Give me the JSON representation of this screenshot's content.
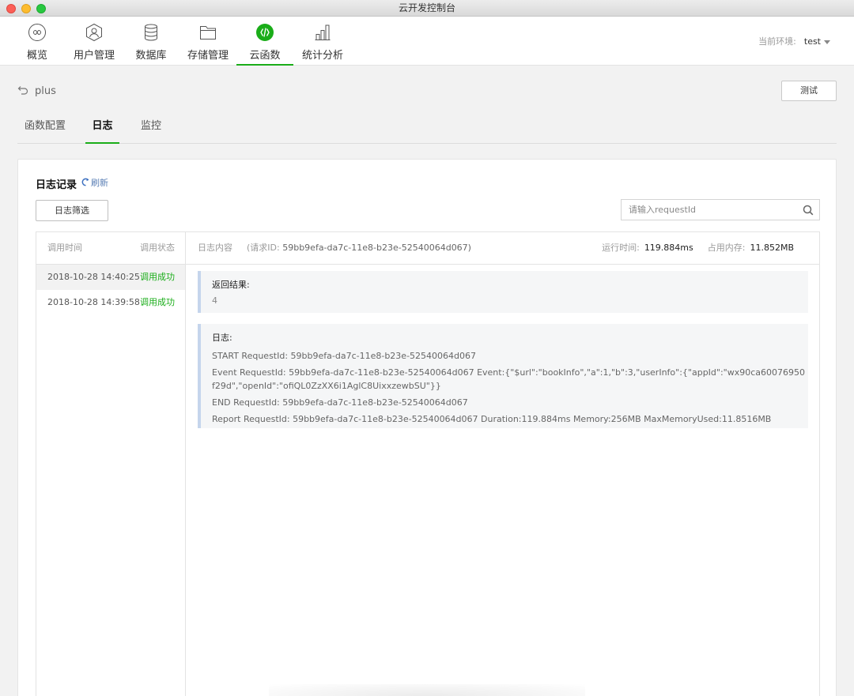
{
  "window": {
    "title": "云开发控制台"
  },
  "nav": {
    "items": [
      {
        "label": "概览",
        "icon": "infinity-icon"
      },
      {
        "label": "用户管理",
        "icon": "user-icon"
      },
      {
        "label": "数据库",
        "icon": "database-icon"
      },
      {
        "label": "存储管理",
        "icon": "folder-icon"
      },
      {
        "label": "云函数",
        "icon": "cloud-function-icon",
        "active": true
      },
      {
        "label": "统计分析",
        "icon": "bar-chart-icon"
      }
    ],
    "env_label": "当前环境:",
    "env_value": "test"
  },
  "page": {
    "function_name": "plus",
    "test_button": "测试",
    "tabs": [
      "函数配置",
      "日志",
      "监控"
    ],
    "active_tab": "日志"
  },
  "log": {
    "title": "日志记录",
    "refresh": "刷新",
    "filter_button": "日志筛选",
    "search_placeholder": "请输入requestId",
    "columns": {
      "time": "调用时间",
      "status": "调用状态",
      "content": "日志内容"
    },
    "request_id_label": "(请求ID:",
    "request_id": "59bb9efa-da7c-11e8-b23e-52540064d067)",
    "runtime_label": "运行时间:",
    "runtime_value": "119.884ms",
    "memory_label": "占用内存:",
    "memory_value": "11.852MB",
    "rows": [
      {
        "time": "2018-10-28 14:40:25",
        "status": "调用成功"
      },
      {
        "time": "2018-10-28 14:39:58",
        "status": "调用成功"
      }
    ],
    "result_title": "返回结果:",
    "result_value": "4",
    "log_title": "日志:",
    "log_lines": [
      "START RequestId: 59bb9efa-da7c-11e8-b23e-52540064d067",
      "Event RequestId: 59bb9efa-da7c-11e8-b23e-52540064d067 Event:{\"$url\":\"bookInfo\",\"a\":1,\"b\":3,\"userInfo\":{\"appId\":\"wx90ca60076950f29d\",\"openId\":\"ofiQL0ZzXX6i1AglC8UixxzewbSU\"}}",
      "END RequestId: 59bb9efa-da7c-11e8-b23e-52540064d067",
      "Report RequestId: 59bb9efa-da7c-11e8-b23e-52540064d067 Duration:119.884ms Memory:256MB MaxMemoryUsed:11.8516MB"
    ]
  },
  "colors": {
    "accent": "#1aad19",
    "link": "#5a7fb5",
    "quote_bar": "#c5d5ec"
  }
}
